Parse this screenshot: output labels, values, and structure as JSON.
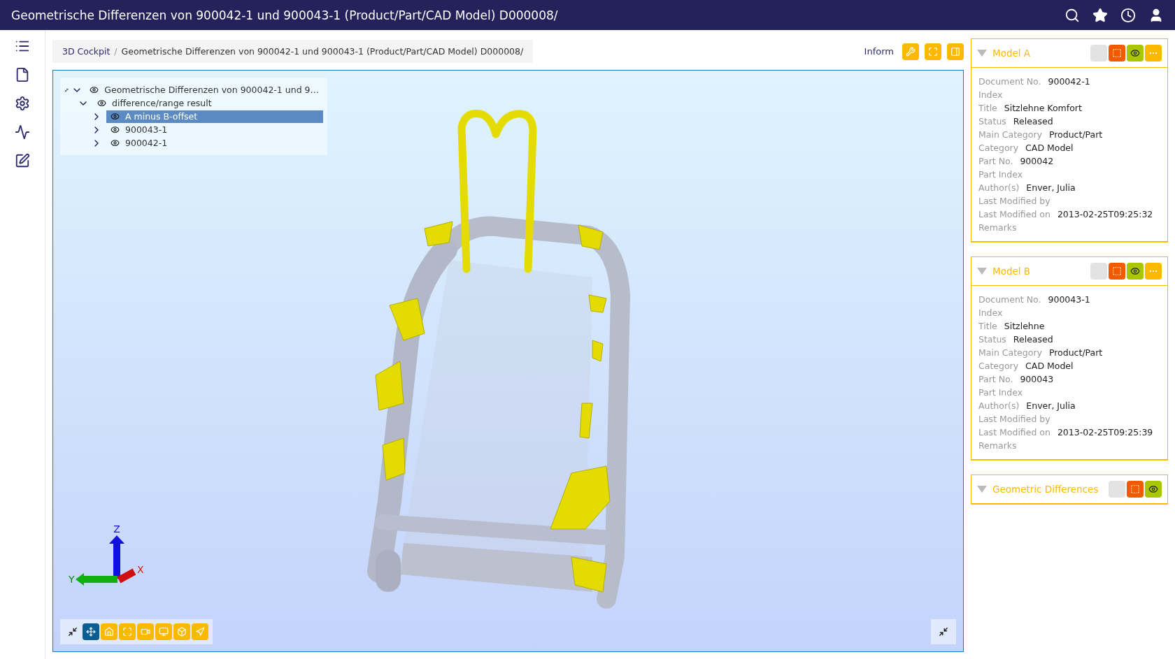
{
  "window": {
    "title": "Geometrische Differenzen von 900042-1 und 900043-1 (Product/Part/CAD Model) D000008/"
  },
  "breadcrumb": [
    {
      "label": "3D Cockpit",
      "link": true
    },
    {
      "label": "Geometrische Differenzen von 900042-1 und 900043-1 (Product/Part/CAD Model) D000008/",
      "link": false
    }
  ],
  "breadcrumb_separator": "/",
  "toolbar": {
    "label": "Inform",
    "buttons": [
      {
        "kind": "wrench"
      },
      {
        "kind": "fit"
      },
      {
        "kind": "panel"
      }
    ]
  },
  "tree": [
    {
      "label": "Geometrische Differenzen von 900042-1 und 9…",
      "expanded": true,
      "selected": false,
      "children": [
        {
          "label": "difference/range result",
          "expanded": true,
          "selected": false,
          "children": [
            {
              "label": "A minus B-offset",
              "expanded": false,
              "selected": true
            },
            {
              "label": "900043-1",
              "expanded": false,
              "selected": false
            },
            {
              "label": "900042-1",
              "expanded": false,
              "selected": false
            }
          ]
        }
      ]
    }
  ],
  "axes": [
    "Z",
    "Y",
    "X"
  ],
  "viewer_toolbar": [
    {
      "kind": "collapse",
      "selected": false
    },
    {
      "kind": "pan",
      "selected": true
    },
    {
      "kind": "home",
      "selected": false
    },
    {
      "kind": "fit",
      "selected": false
    },
    {
      "kind": "camera",
      "selected": false
    },
    {
      "kind": "screen",
      "selected": false
    },
    {
      "kind": "cube",
      "selected": false
    },
    {
      "kind": "pointer",
      "selected": false
    }
  ],
  "panels": [
    {
      "title": "Model A",
      "buttons": [
        {
          "kind": "blank"
        },
        {
          "kind": "select"
        },
        {
          "kind": "eye"
        },
        {
          "kind": "more"
        }
      ],
      "fields": [
        {
          "label": "Document No.",
          "value": "900042-1"
        },
        {
          "label": "Index"
        },
        {
          "label": "Title",
          "value": "Sitzlehne Komfort"
        },
        {
          "label": "Status",
          "value": "Released"
        },
        {
          "label": "Main Category",
          "value": "Product/Part"
        },
        {
          "label": "Category",
          "value": "CAD Model"
        },
        {
          "label": "Part No.",
          "value": "900042"
        },
        {
          "label": "Part Index"
        },
        {
          "label": "Author(s)",
          "value": "Enver, Julia"
        },
        {
          "label": "Last Modified by"
        },
        {
          "label": "Last Modified on",
          "value": "2013-02-25T09:25:32"
        },
        {
          "label": "Remarks"
        }
      ]
    },
    {
      "title": "Model B",
      "buttons": [
        {
          "kind": "blank"
        },
        {
          "kind": "select"
        },
        {
          "kind": "eye"
        },
        {
          "kind": "more"
        }
      ],
      "fields": [
        {
          "label": "Document No.",
          "value": "900043-1"
        },
        {
          "label": "Index"
        },
        {
          "label": "Title",
          "value": "Sitzlehne"
        },
        {
          "label": "Status",
          "value": "Released"
        },
        {
          "label": "Main Category",
          "value": "Product/Part"
        },
        {
          "label": "Category",
          "value": "CAD Model"
        },
        {
          "label": "Part No.",
          "value": "900043"
        },
        {
          "label": "Part Index"
        },
        {
          "label": "Author(s)",
          "value": "Enver, Julia"
        },
        {
          "label": "Last Modified by"
        },
        {
          "label": "Last Modified on",
          "value": "2013-02-25T09:25:39"
        },
        {
          "label": "Remarks"
        }
      ]
    },
    {
      "title": "Geometric Differences",
      "buttons": [
        {
          "kind": "blank"
        },
        {
          "kind": "select"
        },
        {
          "kind": "eye"
        }
      ]
    }
  ]
}
